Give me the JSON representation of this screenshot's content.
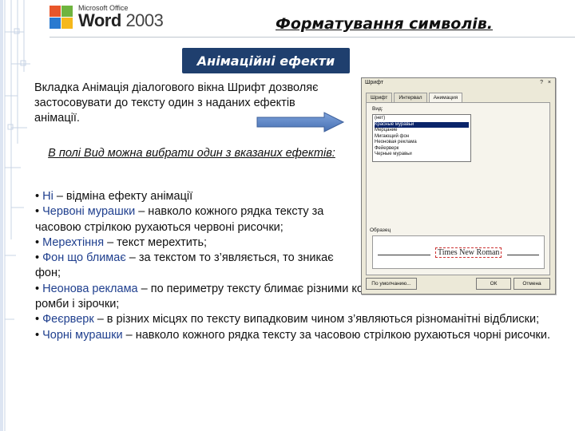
{
  "logo": {
    "brand_small": "Microsoft Office",
    "brand_word": "Word",
    "brand_year": "2003"
  },
  "header": {
    "title": "Форматування символів."
  },
  "section": {
    "badge": "Анімаційні ефекти"
  },
  "intro": {
    "text": "Вкладка Анімація діалогового вікна Шрифт дозволяє застосовувати до тексту один з наданих ефектів анімації."
  },
  "subhead": {
    "text": "В полі Вид можна вибрати один з вказаних ефектів:"
  },
  "effects": [
    {
      "name": "Ні",
      "desc": " – відміна ефекту анімації"
    },
    {
      "name": "Червоні мурашки",
      "desc": " – навколо кожного рядка тексту за часовою стрілкою рухаються червоні рисочки;"
    },
    {
      "name": "Мерехтіння",
      "desc": " – текст мерехтить;"
    },
    {
      "name": "Фон що блимає",
      "desc": " – за текстом то з’являється, то зникає фон;"
    },
    {
      "name": "Неонова реклама",
      "desc": " – по периметру тексту блимає різними кольорами рамка, яка містить в собі ромби і зірочки;"
    },
    {
      "name": "Феєрверк",
      "desc": " – в різних місцях по тексту випадковим чином з’являються різноманітні відблиски;"
    },
    {
      "name": "Чорні мурашки",
      "desc": " – навколо кожного рядка тексту за часовою стрілкою рухаються чорні рисочки."
    }
  ],
  "dialog": {
    "title": "Шрифт",
    "controls": "? ×",
    "tabs": [
      "Шрифт",
      "Интервал",
      "Анимация"
    ],
    "vid_label": "Вид:",
    "list_items": [
      "(нет)",
      "Красные муравьи",
      "Мерцание",
      "Мигающий фон",
      "Неоновая реклама",
      "Фейерверк",
      "Черные муравьи"
    ],
    "selected_index": 1,
    "preview_label": "Образец",
    "preview_text": "Times New Roman",
    "buttons": [
      "По умолчанию...",
      "ОК",
      "Отмена"
    ]
  },
  "colors": {
    "badge_bg": "#1f3f6e",
    "arrow": "#5b86c9",
    "effect_name": "#1f3f8e"
  }
}
